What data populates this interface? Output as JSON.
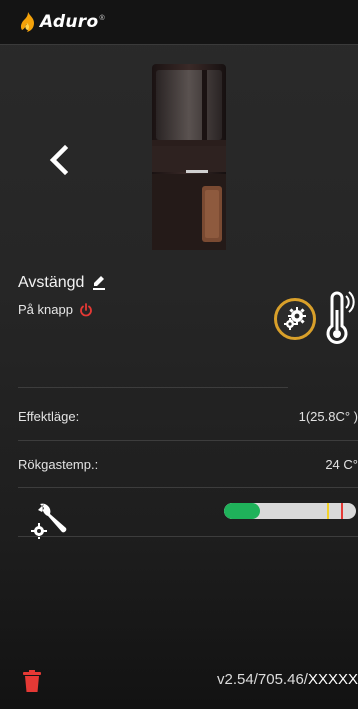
{
  "header": {
    "logo_text": "Aduro",
    "logo_mark": "®"
  },
  "stove": {
    "status": "Avstängd",
    "mode": "På knapp"
  },
  "rows": {
    "effect_label": "Effektläge:",
    "effect_value": "1(25.8C° )",
    "flue_label": "Rökgastemp.:",
    "flue_value": "24 C°"
  },
  "gauge": {
    "level_percent": 27,
    "yellow_marker_percent": 78,
    "red_marker_percent": 89,
    "fill_color": "#1fb25a",
    "track_color": "#d9d9d9"
  },
  "footer": {
    "version_prefix": "v2.54/705.46/",
    "version_suffix": "XXXXX"
  },
  "colors": {
    "accent_orange": "#d9a02a",
    "power_red": "#e53935",
    "trash_red": "#e53935"
  },
  "icons": {
    "back": "chevron-left-icon",
    "edit": "pencil-icon",
    "power": "power-icon",
    "settings": "gears-icon",
    "thermometer": "thermometer-icon",
    "service": "wrench-gear-icon",
    "delete": "trash-icon"
  }
}
